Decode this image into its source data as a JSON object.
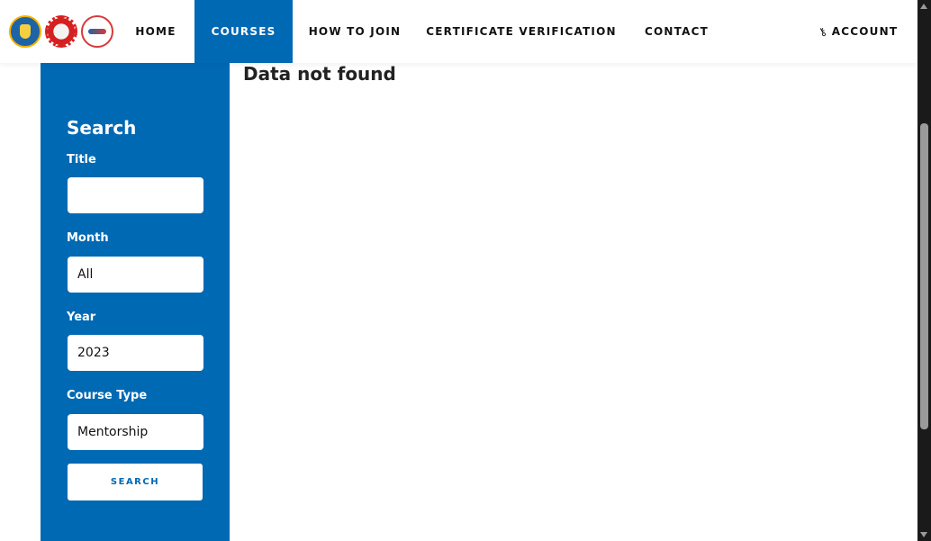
{
  "header": {
    "logos": [
      "kemendikbud-logo",
      "polytechnic-gear-logo",
      "partner-logo"
    ],
    "nav": [
      {
        "label": "HOME",
        "active": false
      },
      {
        "label": "COURSES",
        "active": true
      },
      {
        "label": "HOW TO JOIN",
        "active": false
      },
      {
        "label": "CERTIFICATE VERIFICATION",
        "active": false
      },
      {
        "label": "CONTACT",
        "active": false
      }
    ],
    "account": {
      "icon": "key-icon",
      "label": "ACCOUNT"
    }
  },
  "sidebar": {
    "heading": "Search",
    "fields": [
      {
        "label": "Title",
        "value": "",
        "placeholder": ""
      },
      {
        "label": "Month",
        "value": "All"
      },
      {
        "label": "Year",
        "value": "2023"
      },
      {
        "label": "Course Type",
        "value": "Mentorship"
      }
    ],
    "search_button": "SEARCH"
  },
  "main": {
    "message": "Data not found"
  },
  "colors": {
    "primary": "#0069b4",
    "text": "#222222",
    "background": "#ffffff"
  }
}
